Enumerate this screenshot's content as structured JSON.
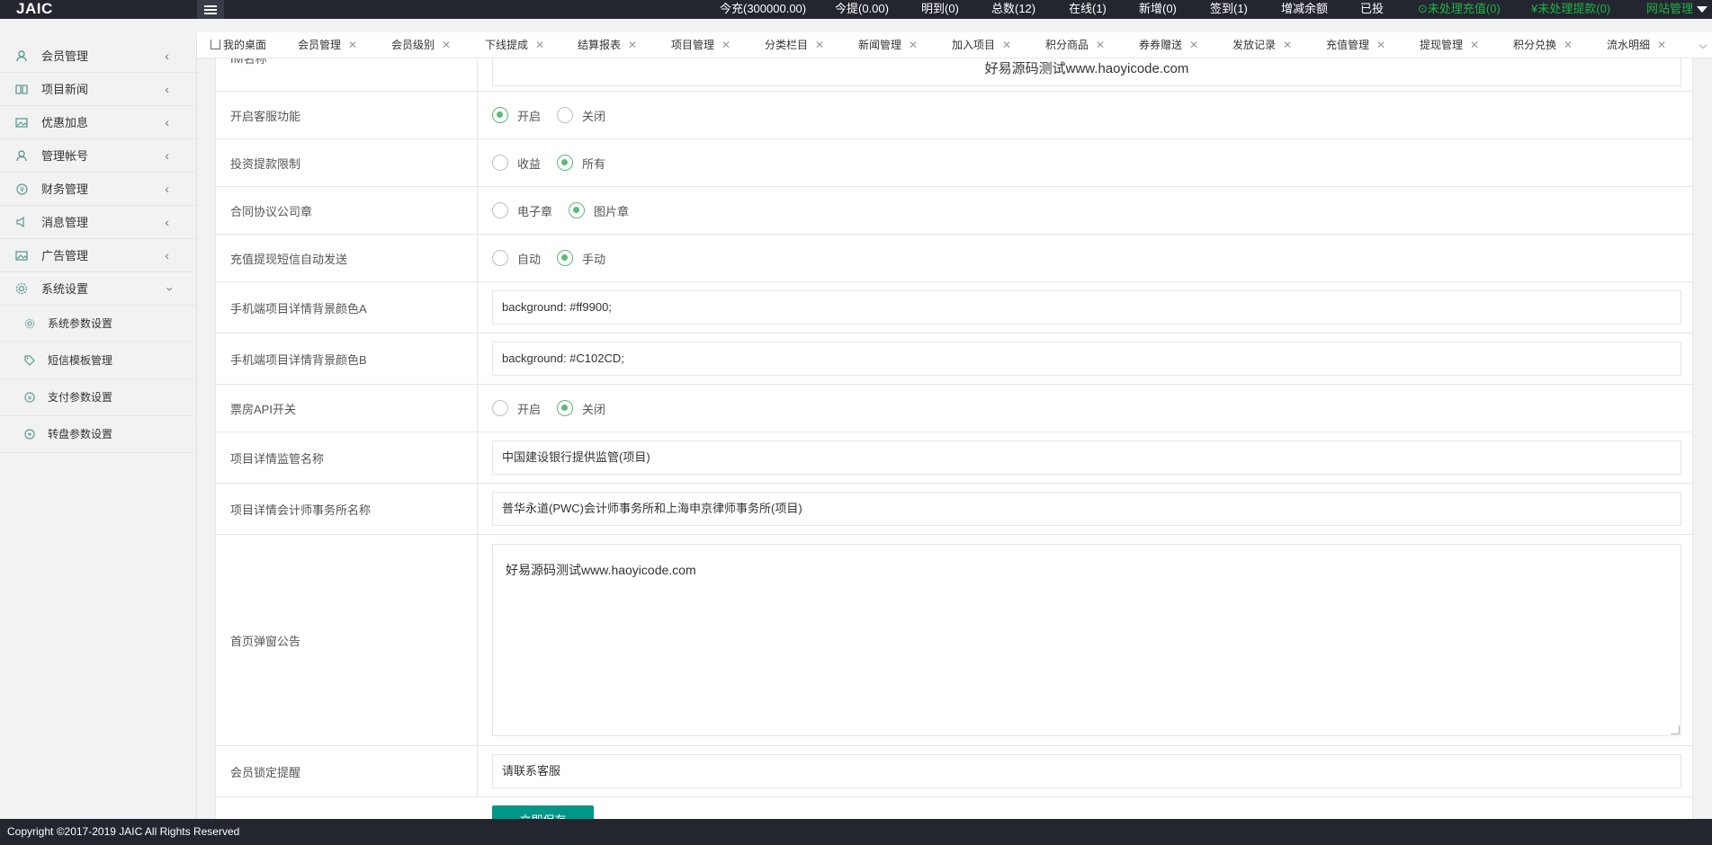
{
  "app": {
    "logo": "JAIC"
  },
  "topbar": {
    "stats": [
      {
        "label": "今充(300000.00)"
      },
      {
        "label": "今提(0.00)"
      },
      {
        "label": "明到(0)"
      },
      {
        "label": "总数(12)"
      },
      {
        "label": "在线(1)"
      },
      {
        "label": "新增(0)"
      },
      {
        "label": "签到(1)"
      },
      {
        "label": "增减余额"
      },
      {
        "label": "已投"
      }
    ],
    "alerts": [
      {
        "label": "未处理充值(0)"
      },
      {
        "label": "未处理提款(0)"
      }
    ],
    "site_menu": "网站管理",
    "colors": {
      "alert": "#22b14c",
      "bar": "#23262e"
    }
  },
  "sidebar": {
    "items": [
      {
        "label": "会员管理",
        "icon": "user-icon"
      },
      {
        "label": "项目新闻",
        "icon": "book-icon"
      },
      {
        "label": "优惠加息",
        "icon": "image-icon"
      },
      {
        "label": "管理帐号",
        "icon": "user-icon"
      },
      {
        "label": "财务管理",
        "icon": "yen-icon"
      },
      {
        "label": "消息管理",
        "icon": "speaker-icon"
      },
      {
        "label": "广告管理",
        "icon": "image-icon"
      },
      {
        "label": "系统设置",
        "icon": "gear-icon"
      }
    ],
    "subitems": [
      {
        "label": "系统参数设置",
        "icon": "gear-icon"
      },
      {
        "label": "短信模板管理",
        "icon": "tag-icon"
      },
      {
        "label": "支付参数设置",
        "icon": "yen-icon"
      },
      {
        "label": "转盘参数设置",
        "icon": "circle-icon"
      }
    ]
  },
  "tabs": [
    {
      "label": "我的桌面"
    },
    {
      "label": "会员管理"
    },
    {
      "label": "会员级别"
    },
    {
      "label": "下线提成"
    },
    {
      "label": "结算报表"
    },
    {
      "label": "项目管理"
    },
    {
      "label": "分类栏目"
    },
    {
      "label": "新闻管理"
    },
    {
      "label": "加入项目"
    },
    {
      "label": "积分商品"
    },
    {
      "label": "券券赠送"
    },
    {
      "label": "发放记录"
    },
    {
      "label": "充值管理"
    },
    {
      "label": "提现管理"
    },
    {
      "label": "积分兑换"
    },
    {
      "label": "流水明细"
    }
  ],
  "form": {
    "im_label": "IM名称",
    "im_value": "好易源码测试www.haoyicode.com",
    "service_label": "开启客服功能",
    "service_opts": [
      "开启",
      "关闭"
    ],
    "invest_label": "投资提款限制",
    "invest_opts": [
      "收益",
      "所有"
    ],
    "seal_label": "合同协议公司章",
    "seal_opts": [
      "电子章",
      "图片章"
    ],
    "sms_label": "充值提现短信自动发送",
    "sms_opts": [
      "自动",
      "手动"
    ],
    "bg_a_label": "手机端项目详情背景颜色A",
    "bg_a_value": "background: #ff9900;",
    "bg_b_label": "手机端项目详情背景颜色B",
    "bg_b_value": "background: #C102CD;",
    "ticket_label": "票房API开关",
    "ticket_opts": [
      "开启",
      "关闭"
    ],
    "supervise_label": "项目详情监管名称",
    "supervise_value": "中国建设银行提供监管(项目)",
    "accountant_label": "项目详情会计师事务所名称",
    "accountant_value": "普华永道(PWC)会计师事务所和上海申京律师事务所(项目)",
    "notice_label": "首页弹窗公告",
    "notice_value": "好易源码测试www.haoyicode.com",
    "lock_label": "会员锁定提醒",
    "lock_value": "请联系客服",
    "save_label": "立即保存"
  },
  "footer": {
    "text": "Copyright ©2017-2019 JAIC All Rights Reserved"
  }
}
